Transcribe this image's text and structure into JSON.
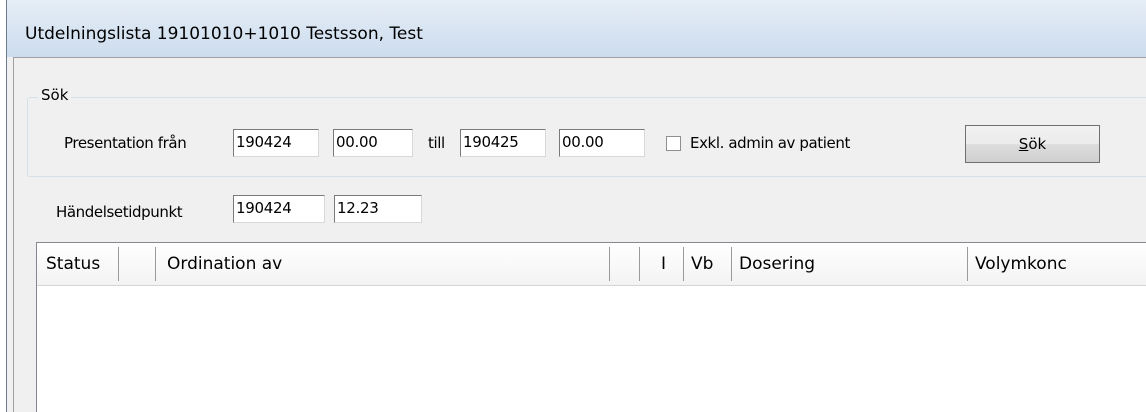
{
  "window": {
    "title": "Utdelningslista  19101010+1010 Testsson, Test"
  },
  "search": {
    "legend": "Sök",
    "presentation_label": "Presentation från",
    "from_date": "190424",
    "from_time": "00.00",
    "till_label": "till",
    "to_date": "190425",
    "to_time": "00.00",
    "exclude_label": "Exkl. admin av patient",
    "exclude_checked": false,
    "search_button_accel": "S",
    "search_button_rest": "ök"
  },
  "event": {
    "label": "Händelsetidpunkt",
    "date": "190424",
    "time": "12.23"
  },
  "table": {
    "columns": [
      "Status",
      "",
      "Ordination av",
      "",
      "I",
      "Vb",
      "Dosering",
      "Volymkonc"
    ],
    "rows": []
  }
}
